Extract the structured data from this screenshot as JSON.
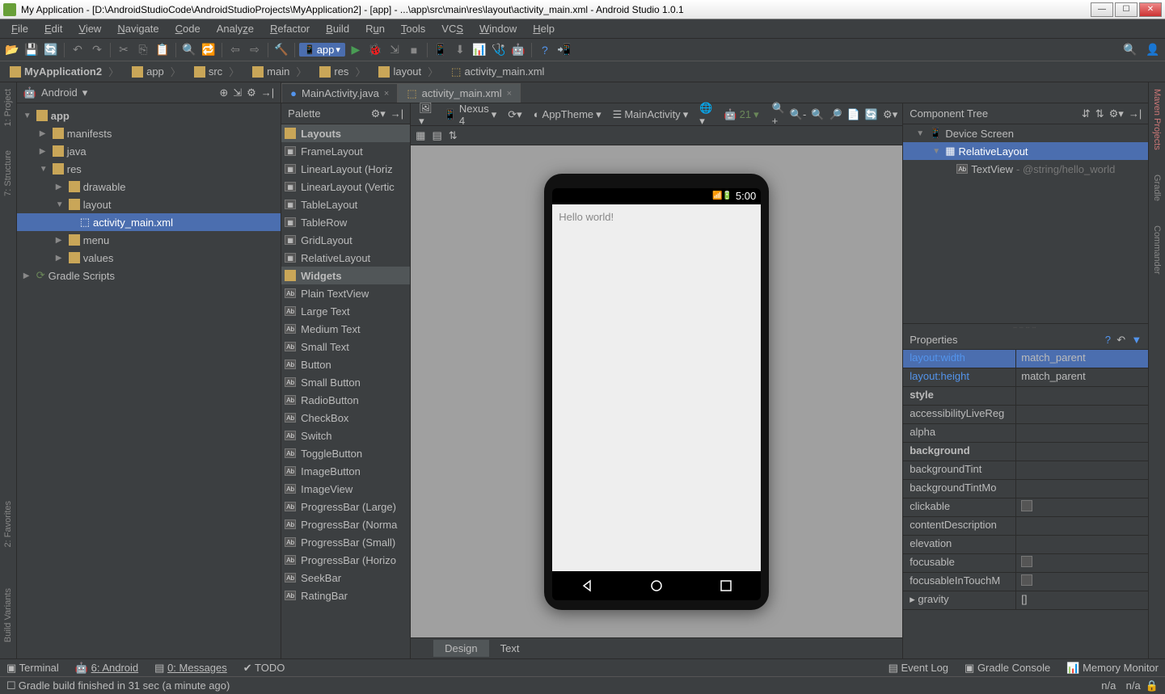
{
  "title": "My Application - [D:\\AndroidStudioCode\\AndroidStudioProjects\\MyApplication2] - [app] - ...\\app\\src\\main\\res\\layout\\activity_main.xml - Android Studio 1.0.1",
  "menu": [
    "File",
    "Edit",
    "View",
    "Navigate",
    "Code",
    "Analyze",
    "Refactor",
    "Build",
    "Run",
    "Tools",
    "VCS",
    "Window",
    "Help"
  ],
  "run_config": "app",
  "breadcrumbs": [
    "MyApplication2",
    "app",
    "src",
    "main",
    "res",
    "layout",
    "activity_main.xml"
  ],
  "project_root_label": "Android",
  "tree": {
    "app": "app",
    "manifests": "manifests",
    "java": "java",
    "res": "res",
    "drawable": "drawable",
    "layout": "layout",
    "activity": "activity_main.xml",
    "menu": "menu",
    "values": "values",
    "gradle": "Gradle Scripts"
  },
  "tabs": [
    {
      "label": "MainActivity.java",
      "active": false
    },
    {
      "label": "activity_main.xml",
      "active": true
    }
  ],
  "palette_header": "Palette",
  "palette": {
    "layouts_hdr": "Layouts",
    "layouts": [
      "FrameLayout",
      "LinearLayout (Horiz",
      "LinearLayout (Vertic",
      "TableLayout",
      "TableRow",
      "GridLayout",
      "RelativeLayout"
    ],
    "widgets_hdr": "Widgets",
    "widgets": [
      "Plain TextView",
      "Large Text",
      "Medium Text",
      "Small Text",
      "Button",
      "Small Button",
      "RadioButton",
      "CheckBox",
      "Switch",
      "ToggleButton",
      "ImageButton",
      "ImageView",
      "ProgressBar (Large)",
      "ProgressBar (Norma",
      "ProgressBar (Small)",
      "ProgressBar (Horizo",
      "SeekBar",
      "RatingBar"
    ]
  },
  "designer": {
    "device": "Nexus 4",
    "theme": "AppTheme",
    "activity": "MainActivity",
    "api": "21",
    "status_time": "5:00",
    "hello": "Hello world!",
    "tabs": [
      "Design",
      "Text"
    ]
  },
  "component_tree_header": "Component Tree",
  "ctree": {
    "root": "Device Screen",
    "rel": "RelativeLayout",
    "tv": "TextView",
    "tv_detail": " - @string/hello_world"
  },
  "properties_header": "Properties",
  "props": [
    {
      "k": "layout:width",
      "v": "match_parent",
      "hl": true,
      "blue": true
    },
    {
      "k": "layout:height",
      "v": "match_parent",
      "blue": true
    },
    {
      "k": "style",
      "v": "",
      "bold": true
    },
    {
      "k": "accessibilityLiveReg",
      "v": ""
    },
    {
      "k": "alpha",
      "v": ""
    },
    {
      "k": "background",
      "v": "",
      "bold": true
    },
    {
      "k": "backgroundTint",
      "v": ""
    },
    {
      "k": "backgroundTintMo",
      "v": ""
    },
    {
      "k": "clickable",
      "v": "",
      "chk": true
    },
    {
      "k": "contentDescription",
      "v": ""
    },
    {
      "k": "elevation",
      "v": ""
    },
    {
      "k": "focusable",
      "v": "",
      "chk": true
    },
    {
      "k": "focusableInTouchM",
      "v": "",
      "chk": true
    },
    {
      "k": "gravity",
      "v": "[]",
      "arrow": true
    }
  ],
  "bottom_tools": {
    "terminal": "Terminal",
    "android": "6: Android",
    "messages": "0: Messages",
    "todo": "TODO",
    "eventlog": "Event Log",
    "gradle": "Gradle Console",
    "memory": "Memory Monitor"
  },
  "status_msg": "Gradle build finished in 31 sec (a minute ago)",
  "status_right": "n/a",
  "vtabs_left": [
    "1: Project",
    "7: Structure",
    "2: Favorites",
    "Build Variants"
  ],
  "vtabs_right": [
    "Maven Projects",
    "Gradle",
    "Commander"
  ]
}
